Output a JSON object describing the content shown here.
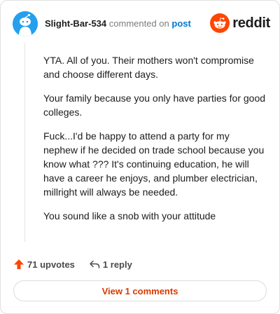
{
  "comment": {
    "username": "Slight-Bar-534",
    "commented_on": "commented on",
    "post_link": "post",
    "brand": "reddit",
    "paragraphs": [
      "YTA. All of you. Their mothers won't compromise and choose different days.",
      "Your family because you only have parties for good colleges.",
      "Fuck...I'd be happy to attend a party for my nephew if he decided on trade school because you know what ??? It's continuing education, he will have a career he enjoys, and plumber electrician, millright will always be needed.",
      "You sound like a snob with your attitude"
    ],
    "upvotes": "71 upvotes",
    "replies": "1 reply",
    "view_comments_label": "View 1 comments"
  },
  "icons": {
    "avatar": "snoo-avatar-icon",
    "brand": "reddit-logo-icon",
    "upvote": "upvote-arrow-icon",
    "reply": "reply-arrow-icon"
  },
  "colors": {
    "accent": "#ff4500",
    "link": "#0079d3",
    "avatar_bg": "#24a0ed",
    "button_text": "#d93900"
  }
}
